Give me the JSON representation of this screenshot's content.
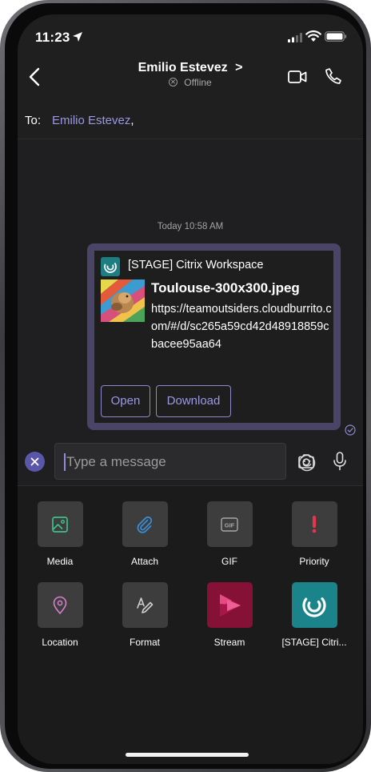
{
  "status_bar": {
    "time": "11:23"
  },
  "header": {
    "contact_name": "Emilio Estevez",
    "contact_chevron": ">",
    "presence": "Offline"
  },
  "recipients": {
    "label": "To:",
    "name": "Emilio Estevez",
    "separator": ","
  },
  "conversation": {
    "timestamp": "Today 10:58 AM",
    "card": {
      "app_name": "[STAGE] Citrix Workspace",
      "file_name": "Toulouse-300x300.jpeg",
      "url": "https://teamoutsiders.cloudburrito.com/#/d/sc265a59cd42d48918859cbacee95aa64",
      "buttons": [
        "Open",
        "Download"
      ]
    }
  },
  "compose": {
    "placeholder": "Type a message"
  },
  "extensions": [
    {
      "label": "Media",
      "icon": "image-icon"
    },
    {
      "label": "Attach",
      "icon": "paperclip-icon"
    },
    {
      "label": "GIF",
      "icon": "gif-icon"
    },
    {
      "label": "Priority",
      "icon": "exclamation-icon"
    },
    {
      "label": "Location",
      "icon": "location-pin-icon"
    },
    {
      "label": "Format",
      "icon": "format-pen-icon"
    },
    {
      "label": "Stream",
      "icon": "stream-play-icon"
    },
    {
      "label": "[STAGE] Citri...",
      "icon": "citrix-icon"
    }
  ],
  "colors": {
    "accent": "#9a98e6",
    "bubble": "#4a4567",
    "stream": "#861137",
    "citrix": "#1a848a"
  }
}
